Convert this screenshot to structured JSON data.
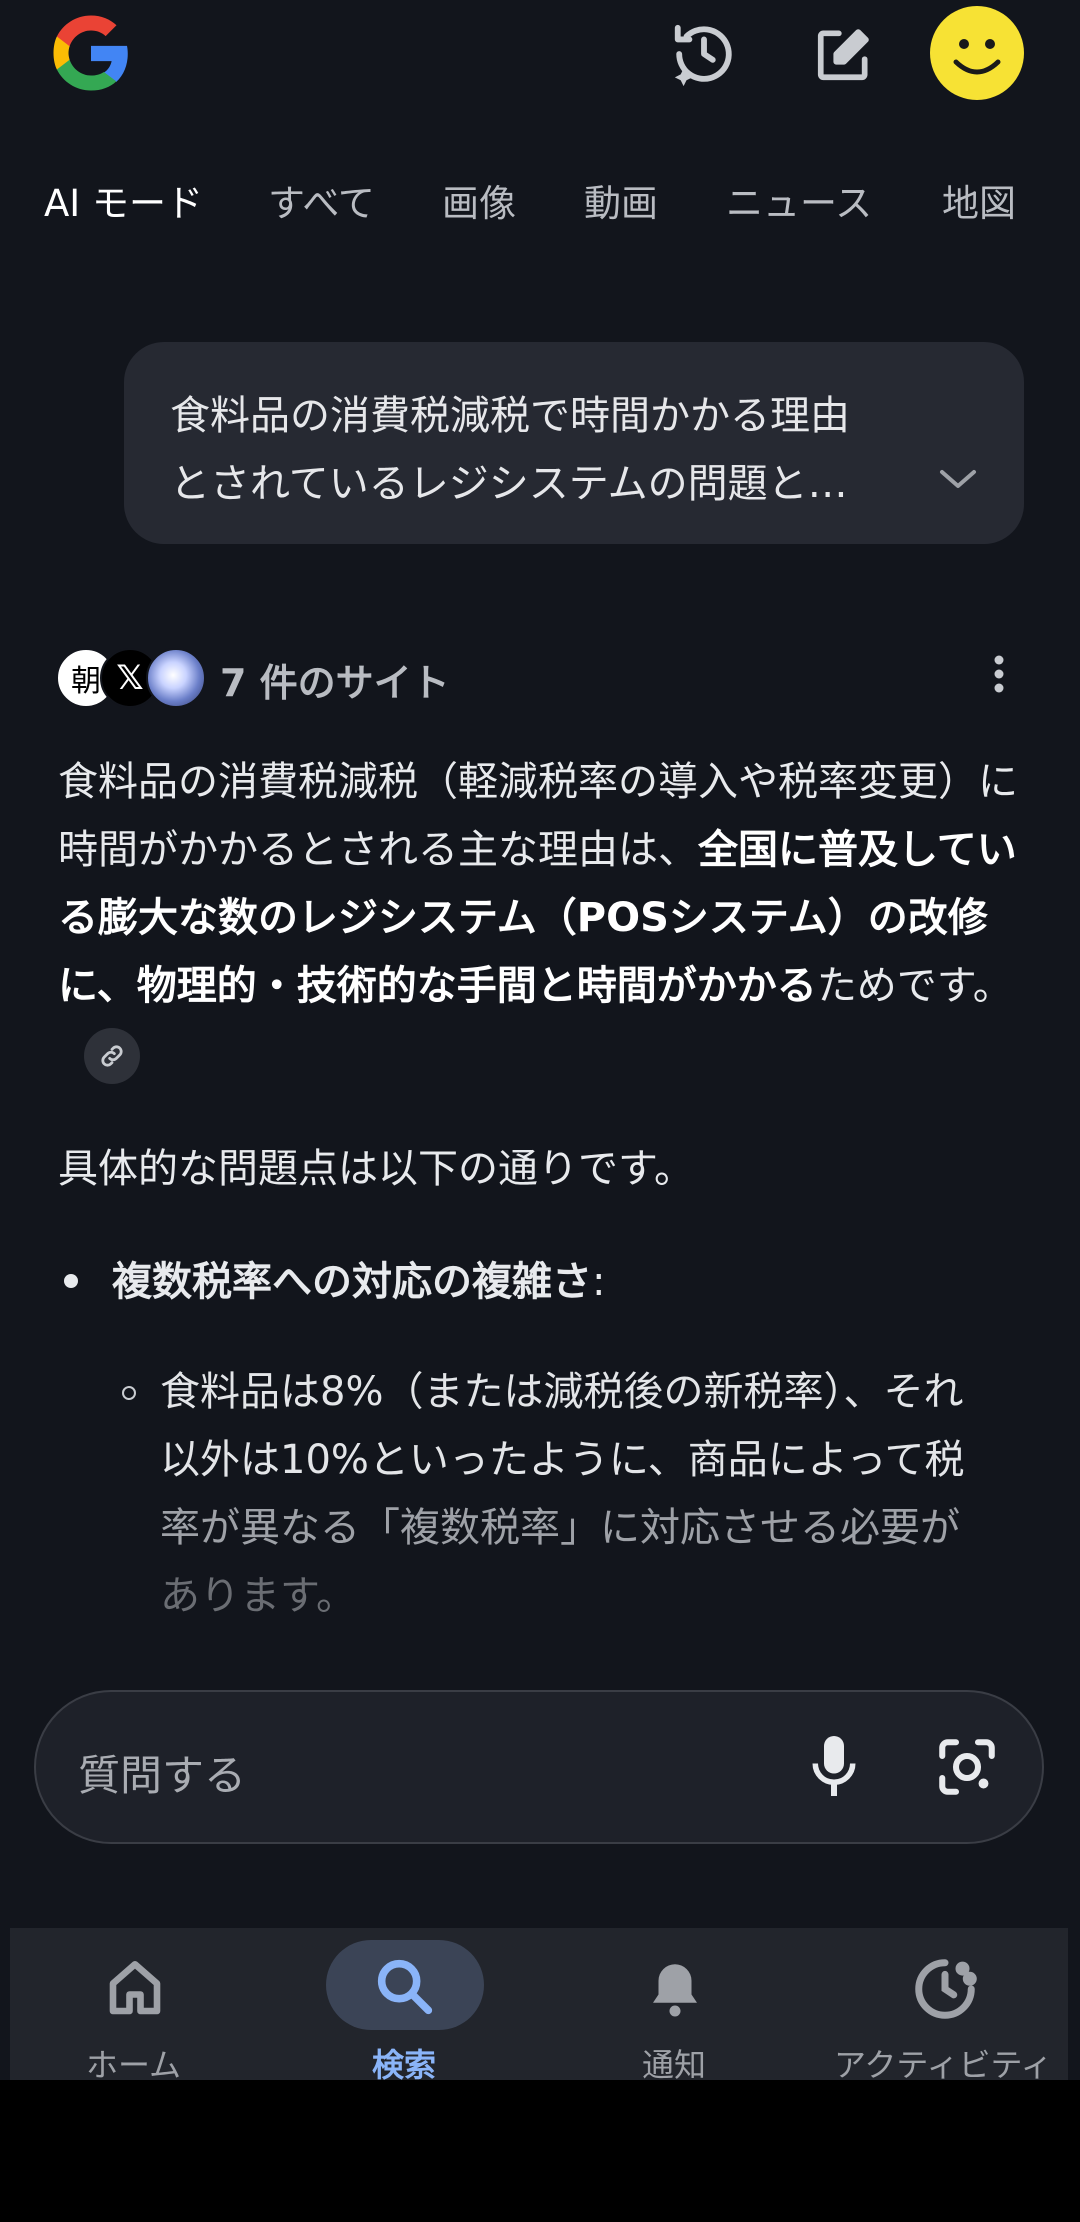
{
  "header": {
    "logo": "google-g-logo",
    "icons": [
      "ai-history-icon",
      "edit-icon",
      "avatar-smiley"
    ]
  },
  "tabs": [
    {
      "label": "AI モード",
      "active": true
    },
    {
      "label": "すべて"
    },
    {
      "label": "画像"
    },
    {
      "label": "動画"
    },
    {
      "label": "ニュース"
    },
    {
      "label": "地図"
    }
  ],
  "query": {
    "line1": "食料品の消費税減税で時間かかる理由",
    "line2": "とされているレジシステムの問題と…"
  },
  "sources": {
    "asahi_char": "朝",
    "x_char": "𝕏",
    "count_label": "7 件のサイト"
  },
  "answer": {
    "p1_a": "食料品の消費税減税（軽減税率の導入や税率変更）に時間がかかるとされる主な理由は、",
    "p1_bold": "全国に普及している膨大な数のレジシステム（POSシステム）の改修に、物理的・技術的な手間と時間がかかる",
    "p1_b": "ためです。",
    "p2": "具体的な問題点は以下の通りです。",
    "bullet1_bold": "複数税率への対応の複雑さ",
    "bullet1_colon": ":",
    "sub1_line1": "食料品は8%（または減税後の新税率）、それ",
    "sub1_line2": "以外は10%といったように、商品によって税",
    "sub1_line3": "率が異なる「複数税率」に対応させる必要が",
    "sub1_line4": "あります。"
  },
  "input": {
    "placeholder": "質問する"
  },
  "nav": {
    "home": "ホーム",
    "search": "検索",
    "notifications": "通知",
    "activity": "アクティビティ"
  },
  "colors": {
    "background": "#12151c",
    "accent": "#8ab4f8",
    "avatar": "#f7e234"
  }
}
